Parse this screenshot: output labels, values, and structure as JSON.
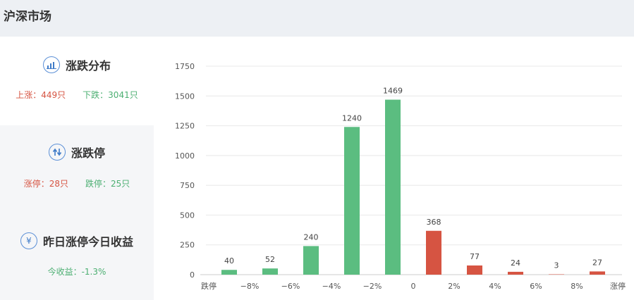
{
  "header": {
    "title": "沪深市场"
  },
  "dist": {
    "title": "涨跌分布",
    "icon": "bar-chart-icon",
    "up_label": "上涨：449只",
    "down_label": "下跌：3041只"
  },
  "limit": {
    "title": "涨跌停",
    "icon": "up-down-arrows-icon",
    "up_label": "涨停：28只",
    "down_label": "跌停：25只"
  },
  "yest": {
    "title": "昨日涨停今日收益",
    "icon": "yen-icon",
    "return_label": "今收益：-1.3%"
  },
  "colors": {
    "up": "#d65442",
    "down": "#5bbd80",
    "accent": "#3f7bc8"
  },
  "chart_data": {
    "type": "bar",
    "categories": [
      "跌停",
      "−8%",
      "−6%",
      "−4%",
      "−2%",
      "0",
      "2%",
      "4%",
      "6%",
      "8%",
      "涨停"
    ],
    "series": [
      {
        "values": [
          40,
          52,
          240,
          1240,
          1469,
          368,
          77,
          24,
          3,
          27
        ]
      }
    ],
    "bar_colors": [
      "down",
      "down",
      "down",
      "down",
      "down",
      "up",
      "up",
      "up",
      "up",
      "up"
    ],
    "yticks": [
      0,
      250,
      500,
      750,
      1000,
      1250,
      1500,
      1750
    ],
    "ylim": [
      0,
      1750
    ],
    "grid": true
  }
}
